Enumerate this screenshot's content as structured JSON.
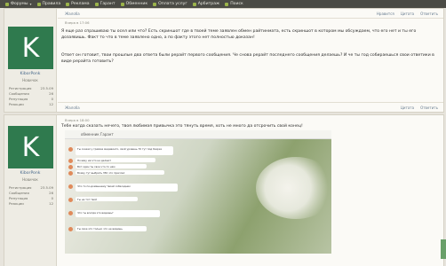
{
  "nav": [
    {
      "label": "Форумы",
      "has_caret": true
    },
    {
      "label": "Правила",
      "has_caret": false
    },
    {
      "label": "Реклама",
      "has_caret": false
    },
    {
      "label": "Гарант",
      "has_caret": false
    },
    {
      "label": "Обменник",
      "has_caret": false
    },
    {
      "label": "Оплата услуг",
      "has_caret": false
    },
    {
      "label": "Арбитраж",
      "has_caret": false
    },
    {
      "label": "Поиск",
      "has_caret": false
    }
  ],
  "post1": {
    "complaint": "Жалоба",
    "actions": [
      "Нравится",
      "Цитата",
      "Ответить"
    ],
    "meta": "Вчера в 17:06",
    "text1": "Я еще раз спрашиваю ты осел или что? Есть скриншот где в твоей теме заявлен обмен райтинмата, есть скриншот в котором мы обсуждаем, что его нет и ты его дозаявишь. Факт то что в теме заявлено одно, а по факту этого нет полностью доказан!",
    "text2": "Ответ он готовит, твои прошлые два ответа были рерайт первого сообщения. Че снова рерайт последнего сообщения делаешь? И че ты год собираешься свои ответики в виде рерайта готовить?",
    "footer_complaint": "Жалоба",
    "footer_actions": [
      "Цитата",
      "Ответить"
    ],
    "user": {
      "avatar": "K",
      "name": "KiborPonk",
      "rank": "Новичок",
      "stats": [
        [
          "Регистрация",
          "23.5.09"
        ],
        [
          "Сообщения",
          "26"
        ],
        [
          "Репутация",
          "0"
        ],
        [
          "Реакции",
          "12"
        ]
      ]
    }
  },
  "post2": {
    "meta": "Вчера в 18:00",
    "actions": [
      "Нравится",
      "Цитата",
      "Ответить"
    ],
    "text": "Тебе когда сказать нечего, твоя любимая привычка это тянуть время, хоть не много да отсрочить свой конец!",
    "user": {
      "avatar": "K",
      "name": "KiborPonk",
      "rank": "Новичок",
      "stats": [
        [
          "Регистрация",
          "23.5.09"
        ],
        [
          "Сообщения",
          "26"
        ],
        [
          "Репутация",
          "0"
        ],
        [
          "Реакции",
          "12"
        ]
      ]
    }
  },
  "chat": {
    "header": "обменник Гарант",
    "messages": [
      "Ты сказал у грамма медиаинто, свой уровень 70 тут под безрез",
      "Почему им это не делают",
      "Вот один ты свое что-то нам",
      "Всему тут выбрать 350 что прислал",
      "Что-то по-домашнему твоей собеседник",
      "Ты не тот твой",
      "Что ты всегда это видишь?",
      "Ты свое это только что не видишь"
    ]
  }
}
